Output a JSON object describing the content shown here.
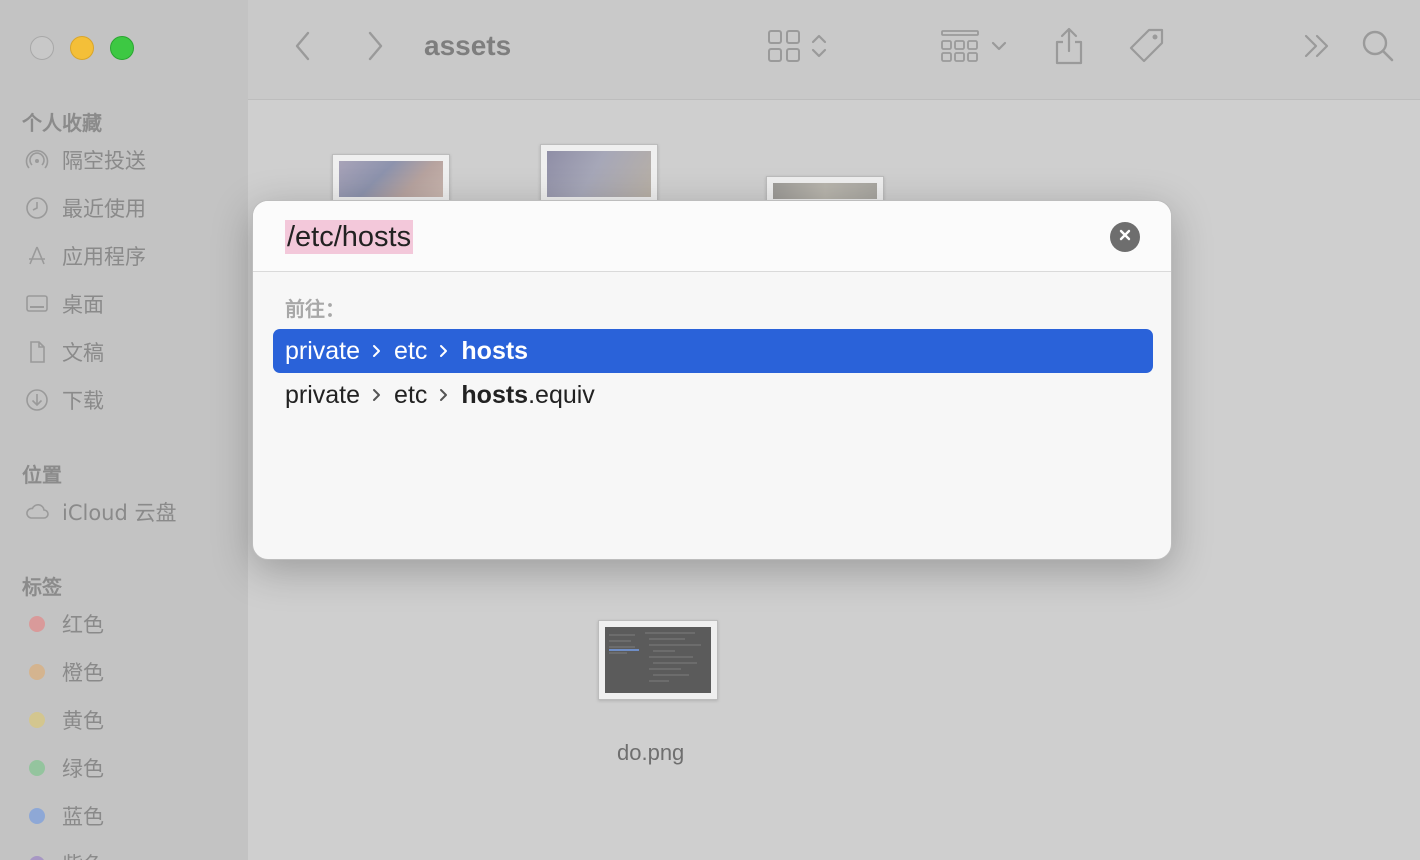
{
  "window": {
    "folder_title": "assets"
  },
  "sidebar": {
    "favorites_title": "个人收藏",
    "favorites": [
      {
        "label": "隔空投送",
        "icon": "airdrop-icon"
      },
      {
        "label": "最近使用",
        "icon": "clock-icon"
      },
      {
        "label": "应用程序",
        "icon": "applications-icon"
      },
      {
        "label": "桌面",
        "icon": "desktop-icon"
      },
      {
        "label": "文稿",
        "icon": "document-icon"
      },
      {
        "label": "下载",
        "icon": "download-icon"
      }
    ],
    "locations_title": "位置",
    "locations": [
      {
        "label": "iCloud 云盘",
        "icon": "cloud-icon"
      }
    ],
    "tags_title": "标签",
    "tags": [
      {
        "label": "红色",
        "color": "#e06a6a"
      },
      {
        "label": "橙色",
        "color": "#e0a86a"
      },
      {
        "label": "黄色",
        "color": "#ddc86a"
      },
      {
        "label": "绿色",
        "color": "#6ac07e"
      },
      {
        "label": "蓝色",
        "color": "#6a90dd"
      },
      {
        "label": "紫色",
        "color": "#a27ad0"
      }
    ]
  },
  "content": {
    "files": [
      {
        "name": "do.png"
      }
    ]
  },
  "dialog": {
    "path_value": "/etc/hosts",
    "goto_label": "前往：",
    "results": [
      {
        "parts": [
          "private",
          "etc"
        ],
        "match": "hosts",
        "suffix": ""
      },
      {
        "parts": [
          "private",
          "etc"
        ],
        "match": "hosts",
        "suffix": ".equiv"
      }
    ]
  },
  "colors": {
    "selection": "#2a62d9",
    "input_highlight": "#f3c8da"
  }
}
